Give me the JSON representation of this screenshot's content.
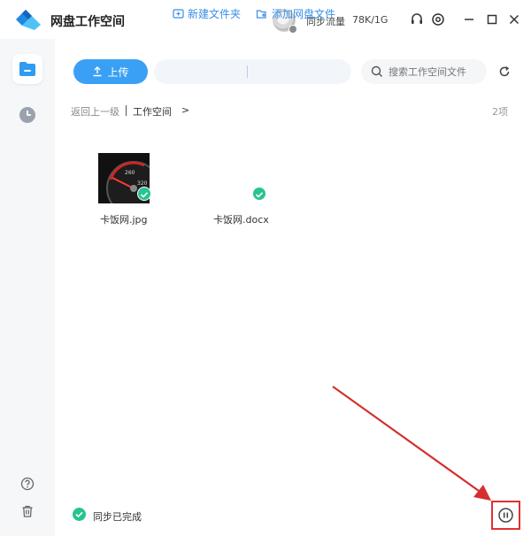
{
  "titlebar": {
    "title": "网盘工作空间",
    "sync_label": "同步流量",
    "sync_value": "78K/1G",
    "icons": [
      "headset-icon",
      "settings-icon",
      "minimize-icon",
      "maximize-icon",
      "close-icon"
    ]
  },
  "sidebar": {
    "items": [
      {
        "name": "folder",
        "icon": "folder-icon",
        "active": true
      },
      {
        "name": "recent",
        "icon": "clock-icon",
        "active": false
      }
    ],
    "bottom": [
      {
        "icon": "help-icon"
      },
      {
        "icon": "trash-icon"
      }
    ]
  },
  "toolbar": {
    "upload_label": "上传",
    "new_folder_label": "新建文件夹",
    "add_cloud_label": "添加网盘文件",
    "search_placeholder": "搜索工作空间文件"
  },
  "breadcrumb": {
    "back_label": "返回上一级",
    "current_label": "工作空间",
    "chevron": ">"
  },
  "count": "2项",
  "files": [
    {
      "name": "卡饭网.jpg",
      "synced": true,
      "thumb": "image"
    },
    {
      "name": "卡饭网.docx",
      "synced": true,
      "thumb": "document"
    }
  ],
  "status": {
    "text": "同步已完成"
  },
  "colors": {
    "accent": "#3aa0f5",
    "success": "#27c393",
    "highlight": "#e03131"
  }
}
